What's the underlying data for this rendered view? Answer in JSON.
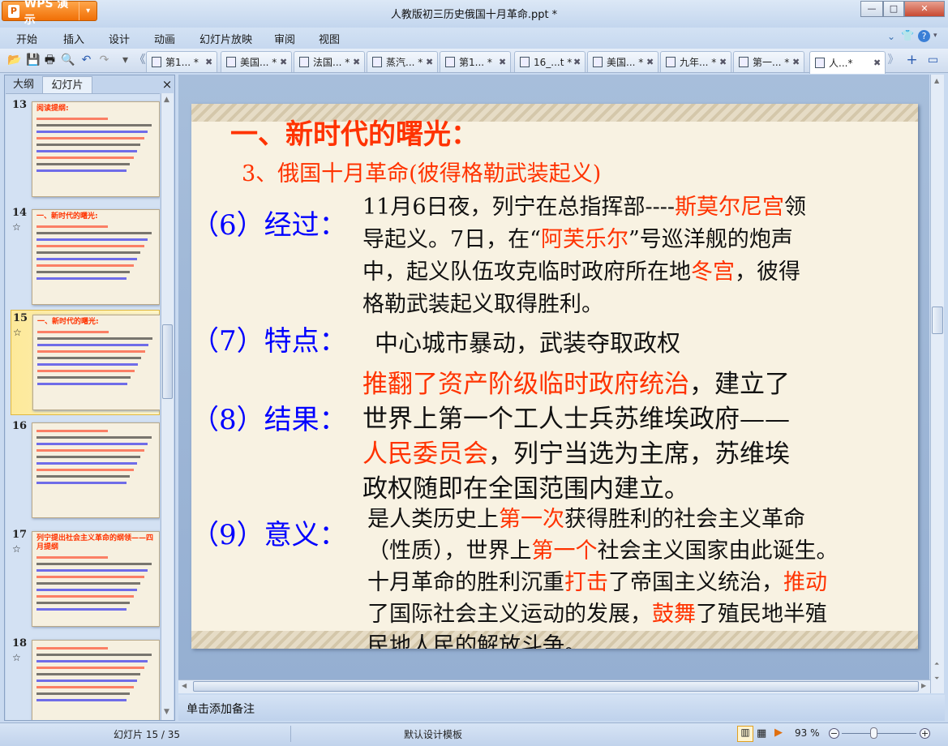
{
  "app": {
    "name": "WPS 演示",
    "window_title": "人教版初三历史俄国十月革命.ppt *"
  },
  "window_controls": {
    "minimize": "—",
    "maximize": "□",
    "close": "✕"
  },
  "menu": [
    "开始",
    "插入",
    "设计",
    "动画",
    "幻灯片放映",
    "审阅",
    "视图"
  ],
  "toolbar_icons": [
    "open-folder",
    "save",
    "print",
    "print-preview",
    "undo",
    "redo",
    "customize",
    "scroll-left"
  ],
  "doc_tabs": [
    {
      "label": "第1... *"
    },
    {
      "label": "美国... *"
    },
    {
      "label": "法国... *"
    },
    {
      "label": "蒸汽... *"
    },
    {
      "label": "第1... *"
    },
    {
      "label": "16_...t *"
    },
    {
      "label": "美国... *"
    },
    {
      "label": "九年... *"
    },
    {
      "label": "第一... *"
    },
    {
      "label": "人...*",
      "active": true
    }
  ],
  "panel": {
    "tab_outline": "大纲",
    "tab_slides": "幻灯片",
    "close": "×"
  },
  "thumbnails": [
    {
      "num": "13",
      "title": "阅读提纲:",
      "selected": false,
      "star": false
    },
    {
      "num": "14",
      "title": "一、新时代的曙光:",
      "selected": false,
      "star": true
    },
    {
      "num": "15",
      "title": "一、新时代的曙光:",
      "selected": true,
      "star": true
    },
    {
      "num": "16",
      "title": "",
      "selected": false,
      "star": false
    },
    {
      "num": "17",
      "title": "列宁提出社会主义革命的纲领——四月提纲",
      "selected": false,
      "star": true
    },
    {
      "num": "18",
      "title": "",
      "selected": false,
      "star": true
    }
  ],
  "slide": {
    "title": "一、新时代的曙光：",
    "subtitle": "3、俄国十月革命(彼得格勒武装起义)",
    "colors": {
      "title": "#ff3300",
      "label": "#0000ff",
      "highlight": "#ff3300",
      "body": "#111111"
    },
    "sections": [
      {
        "label": "（6）经过：",
        "lines": [
          [
            {
              "t": "11月6日夜，列宁在总指挥部----"
            },
            {
              "t": "斯莫尔尼宫",
              "hl": true
            },
            {
              "t": "领"
            }
          ],
          [
            {
              "t": "导起义。7日，在“"
            },
            {
              "t": "阿芙乐尔",
              "hl": true
            },
            {
              "t": "”号巡洋舰的炮声"
            }
          ],
          [
            {
              "t": "中，起义队伍攻克临时政府所在地"
            },
            {
              "t": "冬宫",
              "hl": true
            },
            {
              "t": "，彼得"
            }
          ],
          [
            {
              "t": "格勒武装起义取得胜利。"
            }
          ]
        ]
      },
      {
        "label": "（7）特点：",
        "lines": [
          [
            {
              "t": "中心城市暴动，武装夺取政权"
            }
          ]
        ]
      },
      {
        "label": "（8）结果：",
        "lines": [
          [
            {
              "t": "推翻了资产阶级临时政府统治",
              "hl": true
            },
            {
              "t": "，建立了"
            }
          ],
          [
            {
              "t": "世界上第一个工人士兵苏维埃政府——"
            }
          ],
          [
            {
              "t": "人民委员会",
              "hl": true
            },
            {
              "t": "，列宁当选为主席，苏维埃"
            }
          ],
          [
            {
              "t": "政权随即在全国范围内建立。"
            }
          ]
        ]
      },
      {
        "label": "（9）意义：",
        "lines": [
          [
            {
              "t": "是人类历史上"
            },
            {
              "t": "第一次",
              "hl": true
            },
            {
              "t": "获得胜利的社会主义革命"
            }
          ],
          [
            {
              "t": "（性质），世界上"
            },
            {
              "t": "第一个",
              "hl": true
            },
            {
              "t": "社会主义国家由此诞生。"
            }
          ],
          [
            {
              "t": "十月革命的胜利沉重"
            },
            {
              "t": "打击",
              "hl": true
            },
            {
              "t": "了帝国主义统治，"
            },
            {
              "t": "推动",
              "hl": true
            }
          ],
          [
            {
              "t": "了国际社会主义运动的发展，"
            },
            {
              "t": "鼓舞",
              "hl": true
            },
            {
              "t": "了殖民地半殖"
            }
          ],
          [
            {
              "t": "民地人民的解放斗争。"
            }
          ]
        ]
      }
    ]
  },
  "notes_placeholder": "单击添加备注",
  "status": {
    "slide_counter": "幻灯片 15 / 35",
    "template": "默认设计模板",
    "zoom": "93 %",
    "zoom_percent": 93
  }
}
